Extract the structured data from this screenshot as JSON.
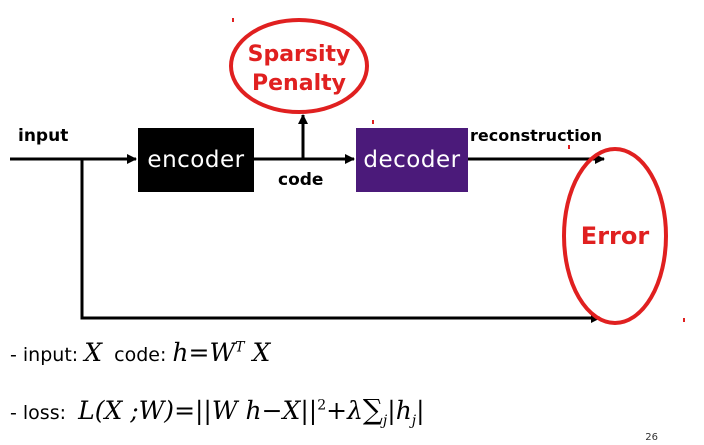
{
  "diagram": {
    "input_label": "input",
    "encoder_label": "encoder",
    "code_label": "code",
    "decoder_label": "decoder",
    "reconstruction_label": "reconstruction",
    "sparsity_line1": "Sparsity",
    "sparsity_line2": "Penalty",
    "error_label": "Error"
  },
  "formulas": {
    "line1_prefix": "- input:",
    "line1_X": "X",
    "line1_code": "code:",
    "line1_expr": "h=W",
    "line1_sup": "T",
    "line1_X2": " X",
    "line2_prefix": "- loss:",
    "line2_expr_a": "L(X ;W)=||W h−X||",
    "line2_sup": "2",
    "line2_expr_b": "+λ",
    "line2_sum": "∑",
    "line2_sub_j": "j",
    "line2_expr_c": "|h",
    "line2_sub_j2": "j",
    "line2_expr_d": "|"
  },
  "page_number": "26",
  "colors": {
    "encoder_bg": "#000000",
    "decoder_bg": "#4b1a7a",
    "highlight": "#e02020"
  }
}
